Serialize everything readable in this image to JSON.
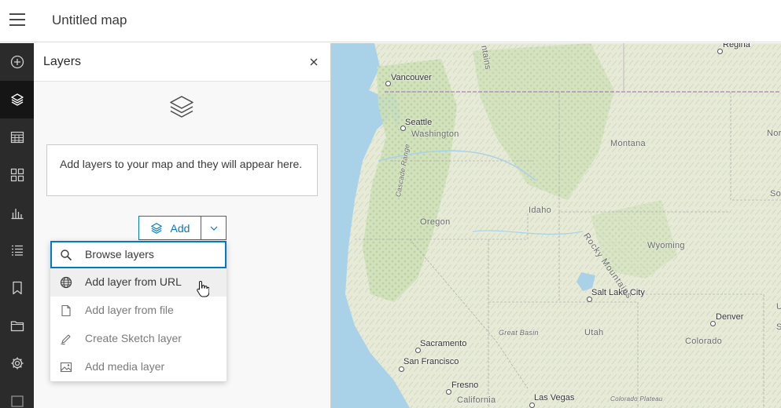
{
  "header": {
    "title": "Untitled map"
  },
  "action_bar": {
    "items": [
      {
        "name": "add",
        "icon": "plus-circle-icon"
      },
      {
        "name": "layers",
        "icon": "layers-icon",
        "active": true
      },
      {
        "name": "tables",
        "icon": "table-icon"
      },
      {
        "name": "basemap",
        "icon": "basemap-grid-icon"
      },
      {
        "name": "charts",
        "icon": "bar-chart-icon"
      },
      {
        "name": "legend",
        "icon": "legend-list-icon"
      },
      {
        "name": "bookmarks",
        "icon": "bookmark-icon"
      },
      {
        "name": "properties",
        "icon": "folder-icon"
      },
      {
        "name": "settings",
        "icon": "gear-icon"
      }
    ]
  },
  "panel": {
    "title": "Layers",
    "empty_message": "Add layers to your map and they will appear here.",
    "add_label": "Add"
  },
  "menu": {
    "items": [
      {
        "label": "Browse layers",
        "icon": "search-icon"
      },
      {
        "label": "Add layer from URL",
        "icon": "globe-icon"
      },
      {
        "label": "Add layer from file",
        "icon": "file-icon"
      },
      {
        "label": "Create Sketch layer",
        "icon": "sketch-pen-icon"
      },
      {
        "label": "Add media layer",
        "icon": "image-icon"
      }
    ]
  },
  "map": {
    "cities": [
      "Regina",
      "Vancouver",
      "Seattle",
      "Salt Lake City",
      "Denver",
      "Sacramento",
      "San Francisco",
      "Fresno",
      "Las Vegas"
    ],
    "regions": [
      "Washington",
      "Montana",
      "Oregon",
      "Idaho",
      "Wyoming",
      "Utah",
      "Colorado",
      "California",
      "Nor",
      "So",
      "U",
      "S"
    ],
    "features": [
      "Cascade Range",
      "Rocky Mountains",
      "Great Basin",
      "Colorado Plateau",
      "ntains"
    ]
  },
  "colors": {
    "accent": "#007ac2",
    "action_bar_bg": "#2b2b2b",
    "water": "#a9d2e8",
    "land": "#e6ead6"
  }
}
